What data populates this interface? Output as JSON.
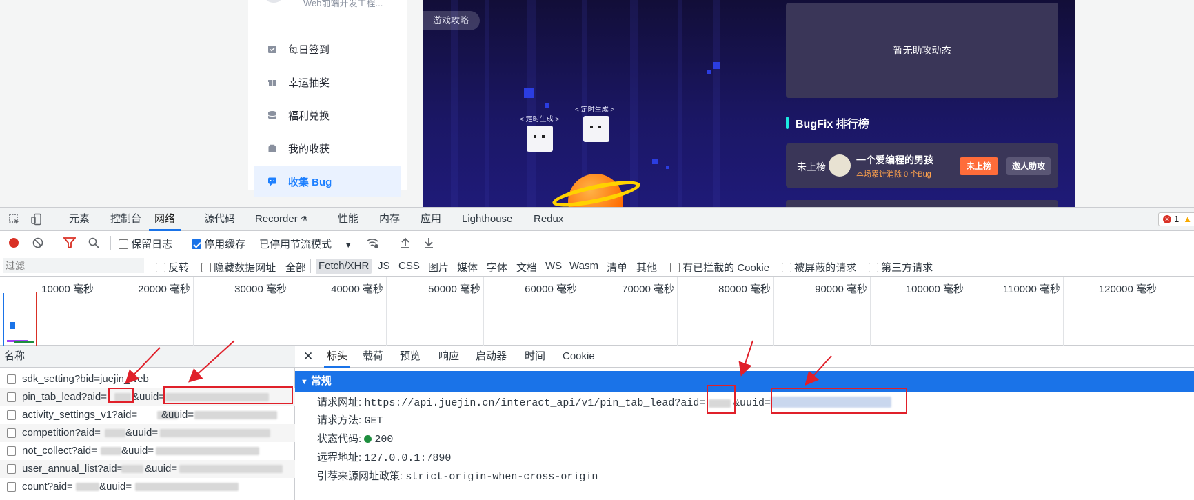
{
  "sidebar": {
    "user_text": "Web前端开发工程...",
    "items": [
      {
        "label": "每日签到",
        "icon": "calendar-check-icon"
      },
      {
        "label": "幸运抽奖",
        "icon": "gift-icon"
      },
      {
        "label": "福利兑换",
        "icon": "coins-icon"
      },
      {
        "label": "我的收获",
        "icon": "bag-icon"
      },
      {
        "label": "收集 Bug",
        "icon": "bug-chat-icon",
        "active": true
      }
    ]
  },
  "banner": {
    "tag": "游戏攻略",
    "bot_label": "< 定时生成 >",
    "no_assist": "暂无助攻动态",
    "rank_title": "BugFix 排行榜",
    "rank_status": "未上榜",
    "rank_user": "一个爱编程的男孩",
    "rank_sub": "本场累计消除 0 个Bug",
    "btn_rank": "未上榜",
    "btn_invite": "邀人助攻"
  },
  "devtools": {
    "tabs": [
      "元素",
      "控制台",
      "网络",
      "源代码",
      "Recorder",
      "性能",
      "内存",
      "应用",
      "Lighthouse",
      "Redux"
    ],
    "active_tab": "网络",
    "error_count": "1",
    "toolbar": {
      "preserve_log": "保留日志",
      "disable_cache": "停用缓存",
      "throttle": "已停用节流模式"
    },
    "filter": {
      "placeholder": "过滤",
      "invert": "反转",
      "hide_data_urls": "隐藏数据网址",
      "types": [
        "全部",
        "Fetch/XHR",
        "JS",
        "CSS",
        "图片",
        "媒体",
        "字体",
        "文档",
        "WS",
        "Wasm",
        "清单",
        "其他"
      ],
      "selected_type": "Fetch/XHR",
      "blocked_cookies": "有已拦截的 Cookie",
      "blocked_requests": "被屏蔽的请求",
      "third_party": "第三方请求"
    },
    "timeline_labels": [
      "10000 毫秒",
      "20000 毫秒",
      "30000 毫秒",
      "40000 毫秒",
      "50000 毫秒",
      "60000 毫秒",
      "70000 毫秒",
      "80000 毫秒",
      "90000 毫秒",
      "100000 毫秒",
      "110000 毫秒",
      "120000 毫秒"
    ],
    "name_header": "名称",
    "requests": [
      "sdk_setting?bid=juejin_web",
      "pin_tab_lead?aid=",
      "activity_settings_v1?aid=",
      "competition?aid=",
      "not_collect?aid=",
      "user_annual_list?aid=",
      "count?aid="
    ],
    "request_suffixes": [
      "",
      "&uuid=",
      "&uuid=",
      "&uuid=",
      "&uuid=",
      "&uuid=",
      "&uuid="
    ],
    "detail_tabs": [
      "标头",
      "载荷",
      "预览",
      "响应",
      "启动器",
      "时间",
      "Cookie"
    ],
    "active_detail_tab": "标头",
    "general_title": "常规",
    "general": [
      {
        "key": "请求网址:",
        "value": "https://api.juejin.cn/interact_api/v1/pin_tab_lead?aid="
      },
      {
        "key": "请求方法:",
        "value": "GET"
      },
      {
        "key": "状态代码:",
        "value": "200"
      },
      {
        "key": "远程地址:",
        "value": "127.0.0.1:7890"
      },
      {
        "key": "引荐来源网址政策:",
        "value": "strict-origin-when-cross-origin"
      }
    ],
    "uuid_suffix": "&uuid="
  },
  "colors": {
    "accent": "#1a73e8",
    "highlight": "#e0202a",
    "juejin_blue": "#1e80ff"
  }
}
